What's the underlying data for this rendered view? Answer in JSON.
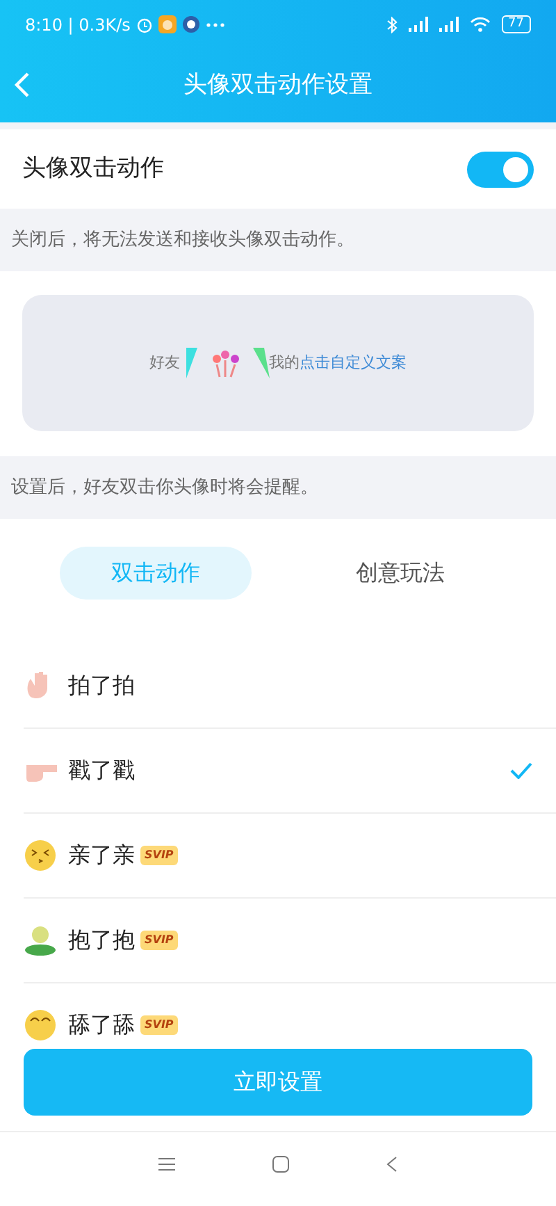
{
  "status_bar": {
    "time": "8:10 | 0.3K/s",
    "battery": "77"
  },
  "header": {
    "title": "头像双击动作设置"
  },
  "toggle": {
    "label": "头像双击动作",
    "on": true
  },
  "toggle_hint": "关闭后，将无法发送和接收头像双击动作。",
  "preview": {
    "friend": "好友",
    "mine": "我的",
    "custom_text": "点击自定义文案"
  },
  "preview_hint": "设置后，好友双击你头像时将会提醒。",
  "tabs": [
    {
      "label": "双击动作",
      "selected": true
    },
    {
      "label": "创意玩法",
      "selected": false
    }
  ],
  "actions": [
    {
      "kind": "wave",
      "label": "拍了拍",
      "selected": false
    },
    {
      "kind": "point",
      "label": "戳了戳",
      "selected": true
    },
    {
      "kind": "kiss",
      "label": "亲了亲",
      "badge": "SVIP",
      "selected": false
    },
    {
      "kind": "hug",
      "label": "抱了抱",
      "badge": "SVIP",
      "selected": false
    },
    {
      "kind": "lick",
      "label": "舔了舔",
      "badge": "SVIP",
      "selected": false
    }
  ],
  "button": "立即设置"
}
